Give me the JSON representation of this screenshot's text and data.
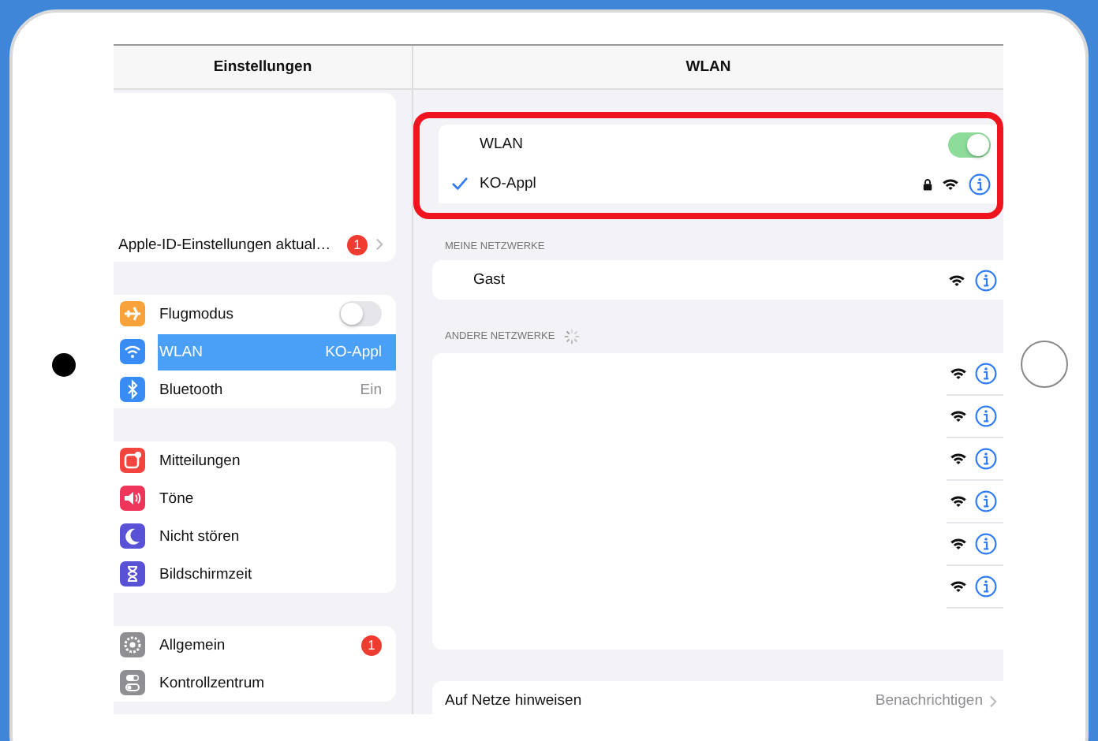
{
  "sidebar": {
    "title": "Einstellungen",
    "apple_id": {
      "label": "Apple-ID-Einstellungen aktual…",
      "badge": "1"
    },
    "groups": [
      {
        "items": [
          {
            "kind": "toggle",
            "label": "Flugmodus",
            "on": false,
            "selected": false,
            "color": "#f7a23b"
          },
          {
            "kind": "value",
            "label": "WLAN",
            "value": "KO-Appl",
            "selected": true,
            "color": "#3a8cf5"
          },
          {
            "kind": "value",
            "label": "Bluetooth",
            "value": "Ein",
            "selected": false,
            "color": "#3a8cf5"
          }
        ]
      },
      {
        "items": [
          {
            "kind": "plain",
            "label": "Mitteilungen",
            "selected": false,
            "color": "#f2453d"
          },
          {
            "kind": "plain",
            "label": "Töne",
            "selected": false,
            "color": "#f0355a"
          },
          {
            "kind": "plain",
            "label": "Nicht stören",
            "selected": false,
            "color": "#5a52d6"
          },
          {
            "kind": "plain",
            "label": "Bildschirmzeit",
            "selected": false,
            "color": "#5a52d6"
          }
        ]
      },
      {
        "items": [
          {
            "kind": "badge",
            "label": "Allgemein",
            "badge": "1",
            "selected": false,
            "color": "#8e8e93"
          },
          {
            "kind": "plain",
            "label": "Kontrollzentrum",
            "selected": false,
            "color": "#8e8e93"
          }
        ]
      }
    ]
  },
  "detail": {
    "title": "WLAN",
    "wlan": {
      "label": "WLAN",
      "on": true,
      "highlighted": true,
      "network": {
        "name": "KO-Appl",
        "connected": true,
        "locked": true
      }
    },
    "my_networks": {
      "header": "MEINE NETZWERKE",
      "items": [
        {
          "name": "Gast",
          "locked": false
        }
      ]
    },
    "other_networks": {
      "header": "ANDERE NETZWERKE",
      "loading": true,
      "items": [
        {
          "locked": false
        },
        {
          "locked": false
        },
        {
          "locked": false
        },
        {
          "locked": false
        },
        {
          "locked": false
        },
        {
          "locked": false
        }
      ]
    },
    "ask": {
      "label": "Auf Netze hinweisen",
      "value": "Benachrichtigen"
    }
  }
}
